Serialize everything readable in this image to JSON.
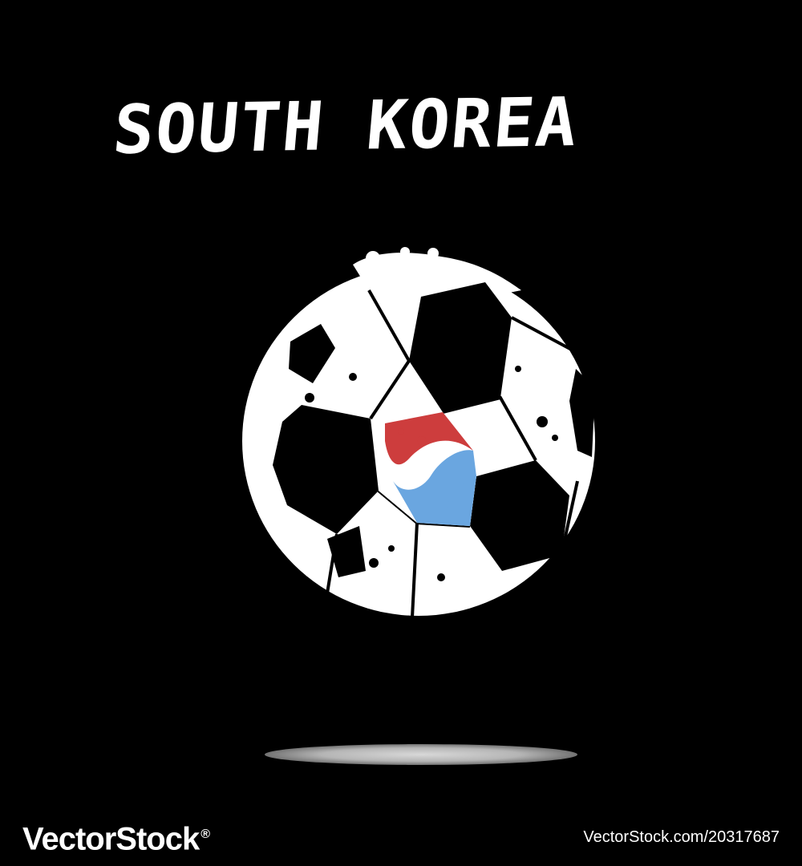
{
  "title": "SOUTH KOREA",
  "watermark": {
    "brand": "VectorStock",
    "trademark": "®",
    "url": "VectorStock.com/20317687"
  },
  "colors": {
    "background": "#000000",
    "ball_white": "#ffffff",
    "ball_black": "#000000",
    "flag_red": "#cd3d3d",
    "flag_blue": "#6aa6e0",
    "shadow": "#c8c8c8"
  }
}
